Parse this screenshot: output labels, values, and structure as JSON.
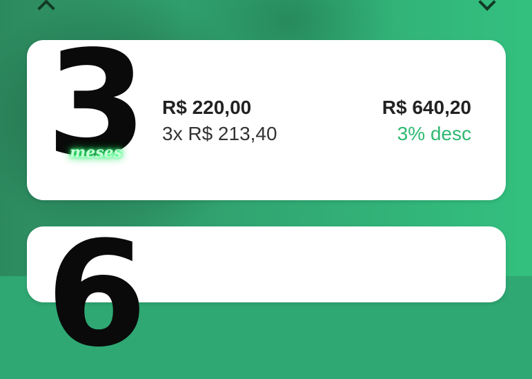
{
  "navigation": {
    "up_icon": "chevron-up-icon",
    "down_icon": "chevron-down-icon"
  },
  "plans": [
    {
      "months_number": "3",
      "months_label": "meses",
      "price": "R$ 220,00",
      "installments": "3x R$ 213,40",
      "total": "R$ 640,20",
      "discount": "3% desc"
    },
    {
      "months_number": "6"
    }
  ],
  "colors": {
    "background": "#31a571",
    "card": "#ffffff",
    "discount": "#2eb872",
    "neon_label": "#39ff7a"
  }
}
